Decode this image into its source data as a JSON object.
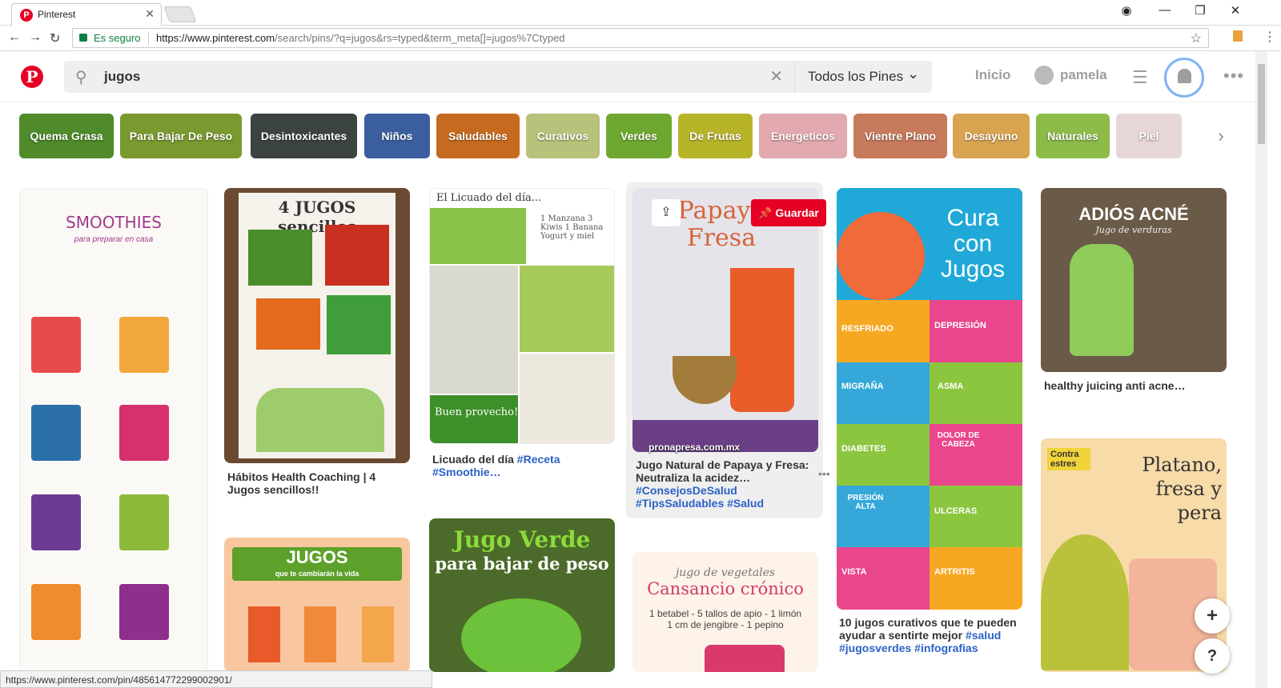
{
  "browser": {
    "tab_title": "Pinterest",
    "tab_icon": "pinterest-favicon",
    "close_glyph": "✕",
    "security_label": "Es seguro",
    "url_prefix": "https://www.pinterest.com",
    "url_rest": "/search/pins/?q=jugos&rs=typed&term_meta[]=jugos%7Ctyped",
    "status_url": "https://www.pinterest.com/pin/485614772299002901/"
  },
  "header": {
    "logo": "P",
    "search_value": "jugos",
    "filter_label": "Todos los Pines",
    "home_label": "Inicio",
    "user_name": "pamela"
  },
  "guides": [
    {
      "label": "Quema Grasa",
      "color": "#4f8a2b"
    },
    {
      "label": "Para Bajar De Peso",
      "color": "#7a9a2f"
    },
    {
      "label": "Desintoxicantes",
      "color": "#3c4440"
    },
    {
      "label": "Niños",
      "color": "#3b5f9e"
    },
    {
      "label": "Saludables",
      "color": "#c66a1f"
    },
    {
      "label": "Curativos",
      "color": "#b8c27a"
    },
    {
      "label": "Verdes",
      "color": "#6fa830"
    },
    {
      "label": "De Frutas",
      "color": "#b8b42a"
    },
    {
      "label": "Energeticos",
      "color": "#e2aab0"
    },
    {
      "label": "Vientre Plano",
      "color": "#c77a5c"
    },
    {
      "label": "Desayuno",
      "color": "#d9a450"
    },
    {
      "label": "Naturales",
      "color": "#8dbb4a"
    },
    {
      "label": "Piel",
      "color": "#e6d6d8"
    }
  ],
  "pins": [
    {
      "caption": "",
      "image": "smoothies-infographic"
    },
    {
      "caption": "Hábitos Health Coaching | 4 Jugos sencillos!!",
      "image": "4-jugos-sencillos"
    },
    {
      "caption": "Licuado del día ",
      "tags": "#Receta #Smoothie…",
      "image": "licuado-del-dia"
    },
    {
      "caption": "Jugo Natural de Papaya y Fresa: Neutraliza la acidez… ",
      "tags": "#ConsejosDeSalud #TipsSaludables #Salud",
      "image": "papaya-fresa",
      "source": "pronapresa.com.mx",
      "save_label": "Guardar"
    },
    {
      "caption": "10 jugos curativos que te pueden ayudar a sentirte mejor ",
      "tags": "#salud #jugosverdes #infografias",
      "image": "cura-con-jugos"
    },
    {
      "caption": "healthy juicing anti acne…",
      "image": "adios-acne"
    },
    {
      "caption": "",
      "image": "jugos-que-te-cambiaran-la-vida"
    },
    {
      "caption": "",
      "image": "jugo-verde-bajar-peso"
    },
    {
      "caption": "",
      "image": "cansancio-cronico"
    },
    {
      "caption": "",
      "image": "platano-fresa-pera"
    }
  ],
  "image_text": {
    "smoothies_title": "SMOOTHIES",
    "smoothies_sub": "para preparar en casa",
    "jugos4_title": "4 JUGOS sencillos",
    "licuado_title": "El Licuado del día...",
    "licuado_list": "1 Manzana 3 Kiwis 1 Banana Yogurt y miel",
    "licuado_foot": "Buen provecho!",
    "papaya_title": "Papaya Fresa",
    "cura_title": "Cura con Jugos",
    "cura_labels": [
      "RESFRIADO",
      "DEPRESIÓN",
      "MIGRAÑA",
      "ASMA",
      "DIABETES",
      "DOLOR DE CABEZA",
      "PRESIÓN ALTA",
      "ULCERAS",
      "VISTA",
      "ARTRITIS"
    ],
    "acne_title": "ADIÓS ACNÉ",
    "acne_sub": "Jugo de verduras",
    "jugos_banner": "JUGOS",
    "jugos_banner_sub": "que te cambiarán la vida",
    "verde_title": "Jugo Verde",
    "verde_sub": "para bajar de peso",
    "cansancio_title": "Cansancio crónico",
    "cansancio_sub": "jugo de vegetales",
    "cansancio_recipe": "1 betabel - 5 tallos de apio - 1 limón 1 cm de jengibre - 1 pepino",
    "platano_title": "Platano, fresa y pera",
    "platano_badge": "Contra estres"
  }
}
